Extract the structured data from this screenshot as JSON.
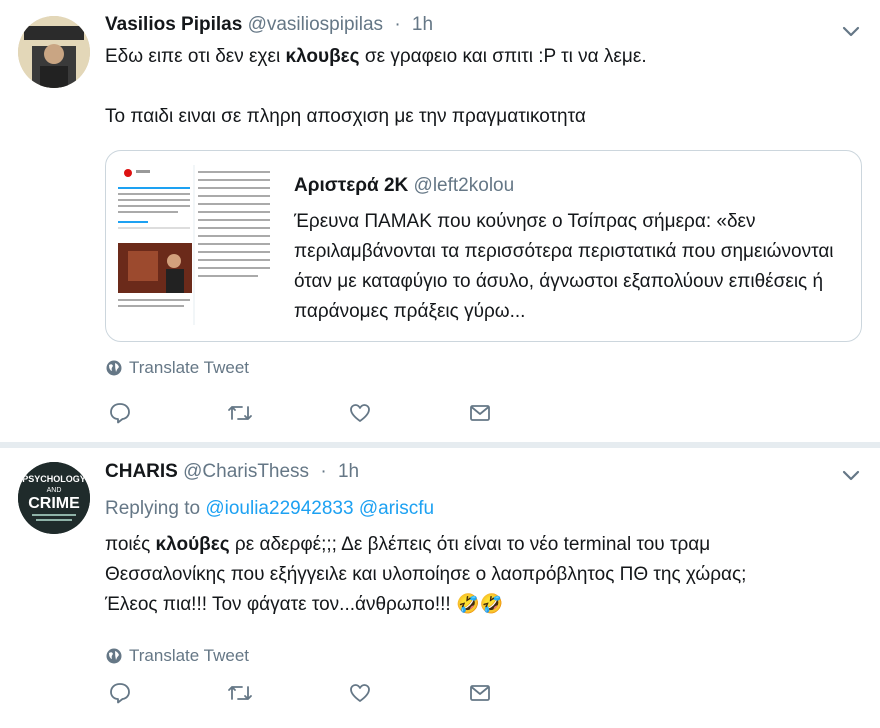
{
  "tweets": [
    {
      "name": "Vasilios Pipilas",
      "handle": "@vasiliospipilas",
      "separator": "·",
      "time": "1h",
      "avatar_text": "ΑΝΑΖΗΤΕΙΤΑΙ ΣΟΦΟΣ ΑΝΘΡΩΠΟΣ",
      "text_before": "Εδω ειπε οτι δεν εχει ",
      "text_bold": "κλουβες",
      "text_after": " σε γραφειο και σπιτι :P τι να λεμε.",
      "text_line2": "Το παιδι ειναι σε πληρη αποσχιση με την πραγματικοτητα",
      "quote": {
        "name": "Αριστερά 2Κ",
        "handle": "@left2kolou",
        "text": "Έρευνα ΠΑΜΑΚ που κούνησε ο Τσίπρας σήμερα: «δεν περιλαμβάνονται τα περισσότερα περιστατικά που σημειώνονται όταν με καταφύγιο το άσυλο, άγνωστοι εξαπολύουν επιθέσεις ή παράνομες πράξεις γύρω..."
      },
      "translate_label": "Translate Tweet"
    },
    {
      "name": "CHARIS",
      "handle": "@CharisThess",
      "separator": "·",
      "time": "1h",
      "avatar_line1": "PSYCHOLOGY",
      "avatar_line2": "AND",
      "avatar_line3": "CRIME",
      "replying_label": "Replying to",
      "mention1": "@ioulia22942833",
      "mention2": "@ariscfu",
      "text_before": "ποιές ",
      "text_bold": "κλούβες",
      "text_after": " ρε αδερφέ;;; Δε βλέπεις ότι είναι το νέο terminal του τραμ",
      "text_line2": "Θεσσαλονίκης που εξήγγειλε και υλοποίησε ο λαοπρόβλητος ΠΘ της χώρας;",
      "text_line3": "Έλεος πια!!! Τον φάγατε τον...άνθρωπο!!! 🤣🤣",
      "translate_label": "Translate Tweet"
    }
  ],
  "colors": {
    "text": "#14171a",
    "secondary": "#657786",
    "link": "#1da1f2",
    "border": "#e6ecf0"
  },
  "icons": [
    "chevron-down-icon",
    "globe-icon",
    "reply-icon",
    "retweet-icon",
    "like-icon",
    "message-icon"
  ]
}
